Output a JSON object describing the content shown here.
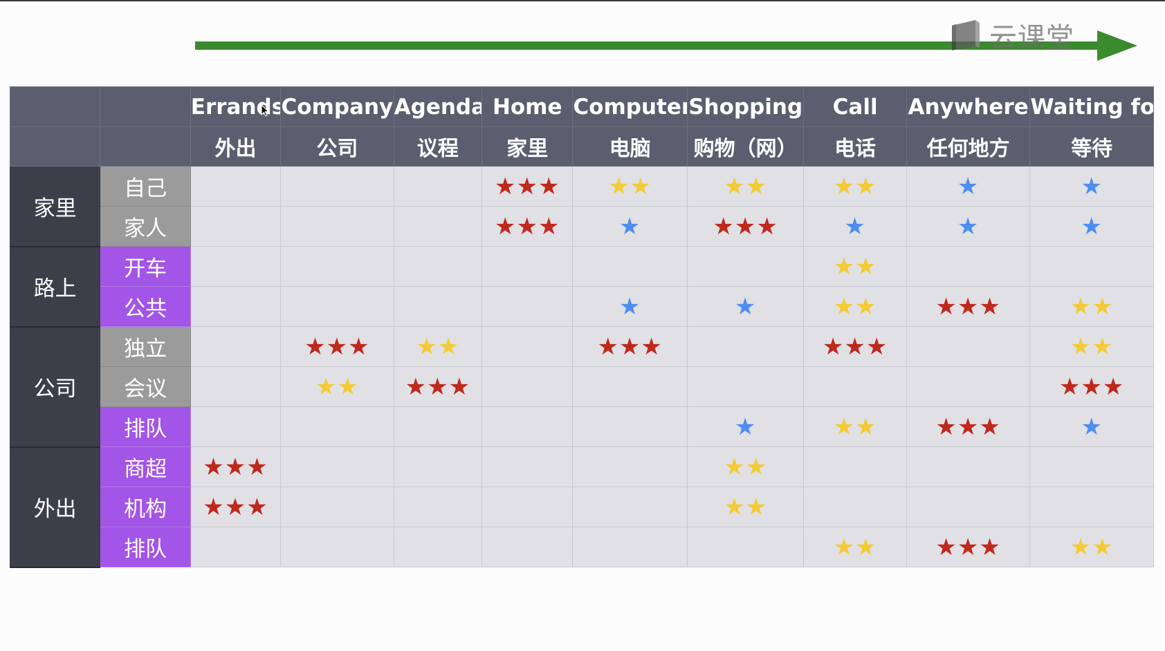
{
  "logo": {
    "text": "云课堂",
    "icon": "book-logo-icon"
  },
  "colors": {
    "arrow": "#3b8a2e",
    "header": "#5a5e6e",
    "group": "#3c3e4a",
    "sub_gray": "#9b9b9b",
    "sub_purple": "#a255e6",
    "star_3": "#c0281c",
    "star_2": "#f3cb35",
    "star_1": "#4d8ef0"
  },
  "table": {
    "columns_en": [
      "Errands",
      "Company",
      "Agenda",
      "Home",
      "Computer",
      "Shopping",
      "Call",
      "Anywhere",
      "Waiting for"
    ],
    "columns_zh": [
      "外出",
      "公司",
      "议程",
      "家里",
      "电脑",
      "购物（网）",
      "电话",
      "任何地方",
      "等待"
    ],
    "groups": [
      "家里",
      "路上",
      "公司",
      "外出"
    ],
    "rows": [
      {
        "label": "自己",
        "style": "gray",
        "ratings": [
          0,
          0,
          0,
          3,
          2,
          2,
          2,
          1,
          1
        ]
      },
      {
        "label": "家人",
        "style": "gray",
        "ratings": [
          0,
          0,
          0,
          3,
          1,
          3,
          1,
          1,
          1
        ]
      },
      {
        "label": "开车",
        "style": "purple",
        "ratings": [
          0,
          0,
          0,
          0,
          0,
          0,
          2,
          0,
          0
        ]
      },
      {
        "label": "公共",
        "style": "purple",
        "ratings": [
          0,
          0,
          0,
          0,
          1,
          1,
          2,
          3,
          2
        ]
      },
      {
        "label": "独立",
        "style": "gray",
        "ratings": [
          0,
          3,
          2,
          0,
          3,
          0,
          3,
          0,
          2
        ]
      },
      {
        "label": "会议",
        "style": "gray",
        "ratings": [
          0,
          2,
          3,
          0,
          0,
          0,
          0,
          0,
          3
        ]
      },
      {
        "label": "排队",
        "style": "purple",
        "ratings": [
          0,
          0,
          0,
          0,
          0,
          1,
          2,
          3,
          1
        ]
      },
      {
        "label": "商超",
        "style": "purple",
        "ratings": [
          3,
          0,
          0,
          0,
          0,
          2,
          0,
          0,
          0
        ]
      },
      {
        "label": "机构",
        "style": "purple",
        "ratings": [
          3,
          0,
          0,
          0,
          0,
          2,
          0,
          0,
          0
        ]
      },
      {
        "label": "排队",
        "style": "purple",
        "ratings": [
          0,
          0,
          0,
          0,
          0,
          0,
          2,
          3,
          2
        ]
      }
    ]
  }
}
